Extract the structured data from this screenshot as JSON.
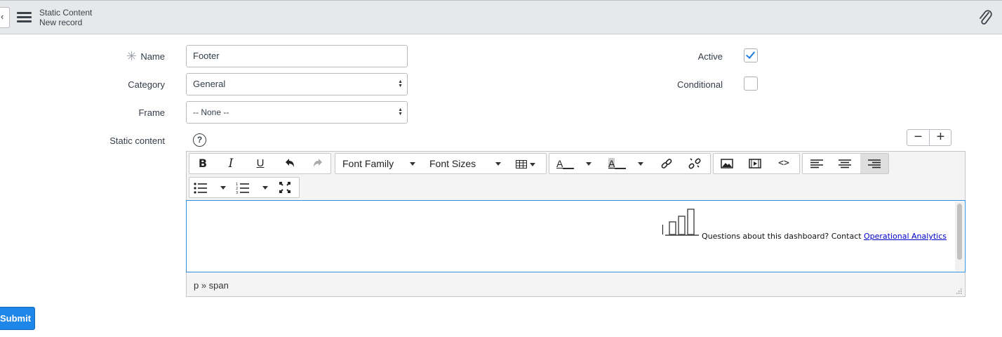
{
  "header": {
    "title": "Static Content",
    "subtitle": "New record"
  },
  "form": {
    "name_label": "Name",
    "name_value": "Footer",
    "category_label": "Category",
    "category_value": "General",
    "frame_label": "Frame",
    "frame_value": "-- None --",
    "static_content_label": "Static content",
    "active_label": "Active",
    "active_checked": true,
    "conditional_label": "Conditional",
    "conditional_checked": false
  },
  "editor": {
    "font_family_label": "Font Family",
    "font_sizes_label": "Font Sizes",
    "content_text": "Questions about this dashboard? Contact ",
    "content_link": "Operational Analytics",
    "path": "p » span"
  },
  "zoom": {
    "minus": "−",
    "plus": "+"
  },
  "submit_label": "Submit",
  "colors": {
    "primary": "#1d86e8",
    "focus_border": "#2b8ee0",
    "header_bg": "#e6e8ea",
    "link": "#0000cc"
  }
}
